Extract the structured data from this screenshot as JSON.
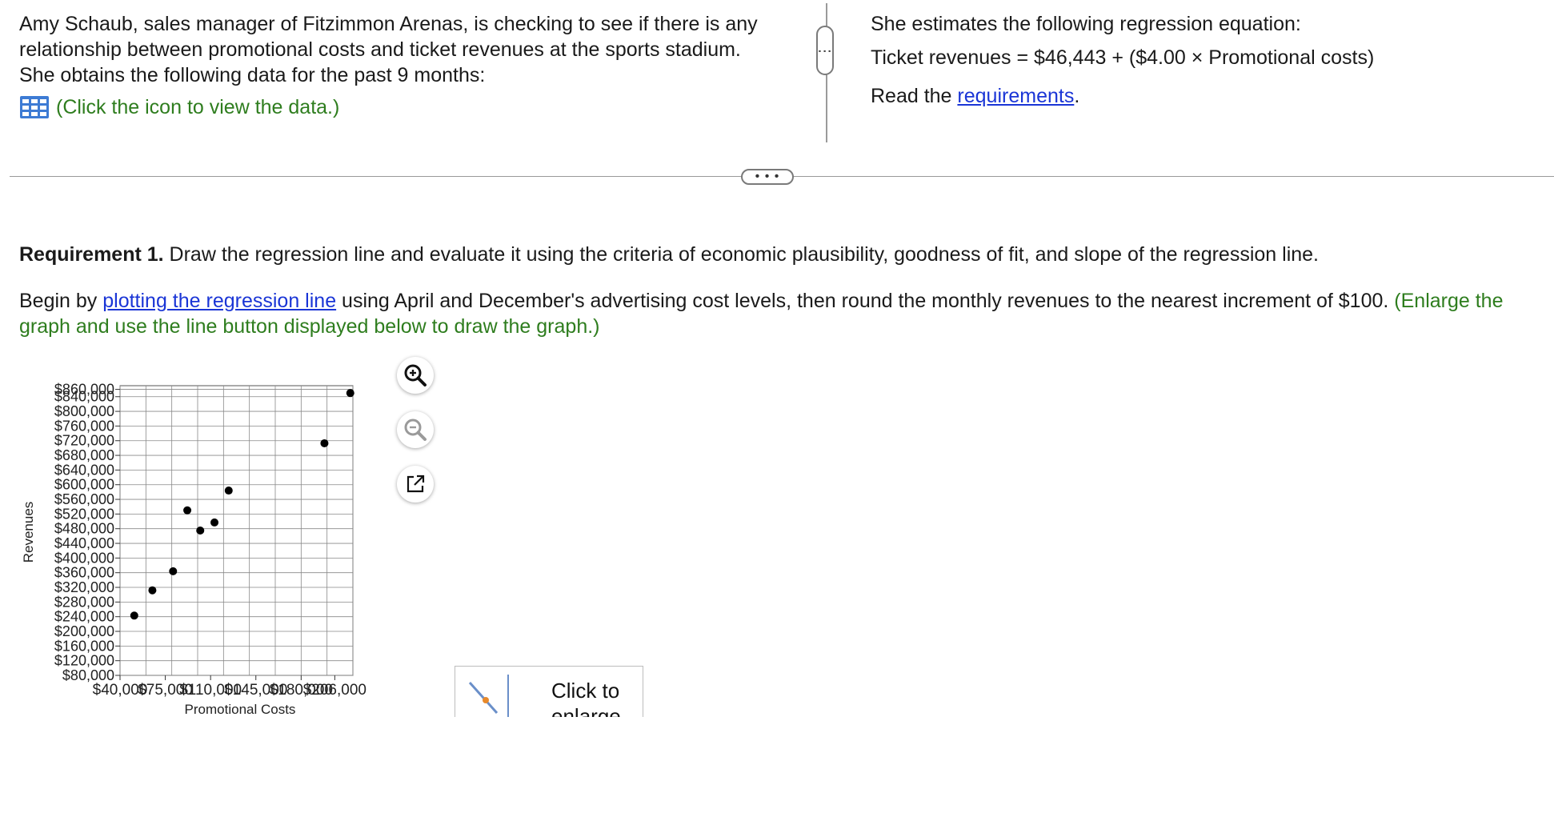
{
  "intro": {
    "text": "Amy Schaub, sales manager of Fitzimmon Arenas, is checking to see if there is any relationship between promotional costs and ticket revenues at the sports stadium. She obtains the following data for the past 9 months:",
    "data_link": "(Click the icon to view the data.)",
    "data_icon": "table-grid-icon"
  },
  "right_panel": {
    "estimate_text": "She estimates the following regression equation:",
    "equation": "Ticket revenues = $46,443 + ($4.00 × Promotional costs)",
    "read_prefix": "Read the ",
    "requirements_link": "requirements",
    "read_suffix": "."
  },
  "dividers": {
    "vertical_handle": "⋮",
    "horizontal_handle": "• • •"
  },
  "requirement1": {
    "bold": "Requirement 1.",
    "text": " Draw the regression line and evaluate it using the criteria of economic plausibility, goodness of fit, and slope of the regression line."
  },
  "begin": {
    "prefix": "Begin by ",
    "link": "plotting the regression line",
    "middle": " using April and December's advertising cost levels, then round the monthly revenues to the nearest increment of $100. ",
    "green": "(Enlarge the graph and use the line button displayed below to draw the graph.)"
  },
  "chart_tools": {
    "zoom_in": "zoom-in-icon",
    "zoom_out": "zoom-out-icon",
    "popout": "popout-icon"
  },
  "enlarge": {
    "label": "Click to enlarge",
    "icon": "line-tool-icon",
    "accent": "#e8892a"
  },
  "colors": {
    "green": "#2e7d1e",
    "link": "#1a35d6",
    "icon_blue": "#3d7bd4"
  },
  "chart_data": {
    "type": "scatter",
    "xlabel": "Promotional Costs",
    "ylabel": "Revenues",
    "xlim": [
      40000,
      220000
    ],
    "ylim": [
      80000,
      870000
    ],
    "x_ticks": [
      40000,
      75000,
      110000,
      145000,
      180000,
      206000
    ],
    "x_tick_labels": [
      "$40,000",
      "$75,000",
      "$110,000",
      "$145,000",
      "$180,000",
      "$206,000"
    ],
    "y_ticks": [
      80000,
      120000,
      160000,
      200000,
      240000,
      280000,
      320000,
      360000,
      400000,
      440000,
      480000,
      520000,
      560000,
      600000,
      640000,
      680000,
      720000,
      760000,
      800000,
      840000,
      860000
    ],
    "y_tick_labels": [
      "$80,000",
      "$120,000",
      "$160,000",
      "$200,000",
      "$240,000",
      "$280,000",
      "$320,000",
      "$360,000",
      "$400,000",
      "$440,000",
      "$480,000",
      "$520,000",
      "$560,000",
      "$600,000",
      "$640,000",
      "$680,000",
      "$720,000",
      "$760,000",
      "$800,000",
      "$840,000",
      "$860,000"
    ],
    "grid": true,
    "points": [
      {
        "x": 51000,
        "y": 243000
      },
      {
        "x": 65000,
        "y": 312000
      },
      {
        "x": 81000,
        "y": 364000
      },
      {
        "x": 92000,
        "y": 530000
      },
      {
        "x": 102000,
        "y": 475000
      },
      {
        "x": 113000,
        "y": 497000
      },
      {
        "x": 124000,
        "y": 584000
      },
      {
        "x": 198000,
        "y": 713000
      },
      {
        "x": 218000,
        "y": 850000
      }
    ]
  }
}
